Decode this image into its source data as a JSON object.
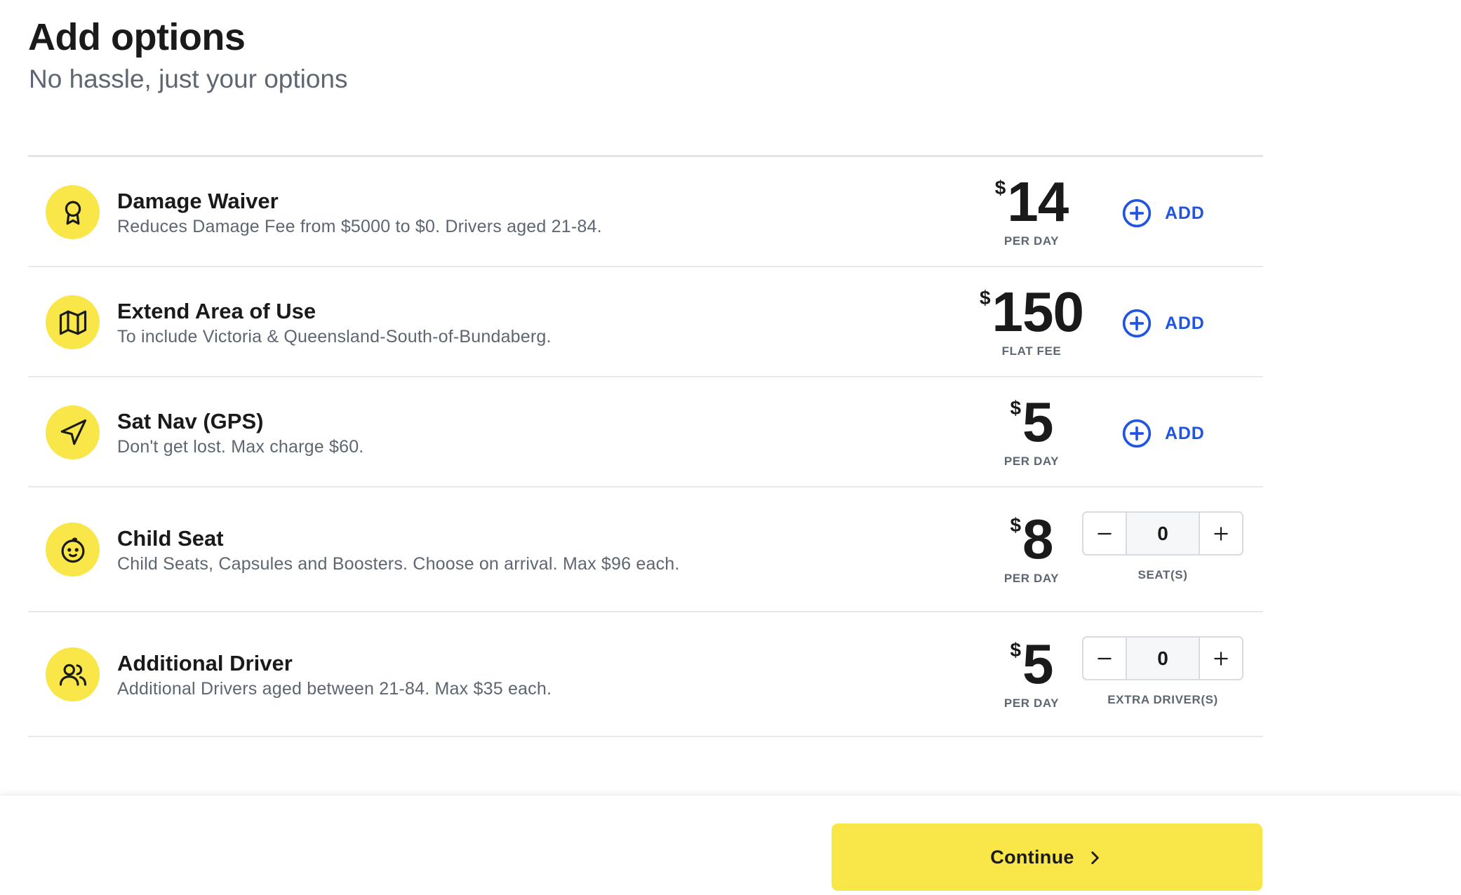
{
  "header": {
    "title": "Add options",
    "subtitle": "No hassle, just your options"
  },
  "options": [
    {
      "icon": "award-ribbon-icon",
      "name": "Damage Waiver",
      "description": "Reduces Damage Fee from $5000 to $0. Drivers aged 21-84.",
      "currency": "$",
      "price": "14",
      "unit": "PER DAY",
      "action": "ADD"
    },
    {
      "icon": "map-icon",
      "name": "Extend Area of Use",
      "description": "To include Victoria & Queensland-South-of-Bundaberg.",
      "currency": "$",
      "price": "150",
      "unit": "FLAT FEE",
      "action": "ADD"
    },
    {
      "icon": "navigation-arrow-icon",
      "name": "Sat Nav (GPS)",
      "description": "Don't get lost. Max charge $60.",
      "currency": "$",
      "price": "5",
      "unit": "PER DAY",
      "action": "ADD"
    },
    {
      "icon": "baby-face-icon",
      "name": "Child Seat",
      "description": "Child Seats, Capsules and Boosters. Choose on arrival. Max $96 each.",
      "currency": "$",
      "price": "8",
      "unit": "PER DAY",
      "quantity": "0",
      "quantity_label": "SEAT(S)"
    },
    {
      "icon": "users-icon",
      "name": "Additional Driver",
      "description": "Additional Drivers aged between 21-84. Max $35 each.",
      "currency": "$",
      "price": "5",
      "unit": "PER DAY",
      "quantity": "0",
      "quantity_label": "EXTRA DRIVER(S)"
    }
  ],
  "footer": {
    "continue_label": "Continue",
    "continue_icon": "chevron-right-icon"
  },
  "colors": {
    "accent_yellow": "#f9e649",
    "link_blue": "#1f55e0",
    "text_dark": "#1a1a1a",
    "text_muted": "#5d6671",
    "divider": "#e7e9ec"
  }
}
